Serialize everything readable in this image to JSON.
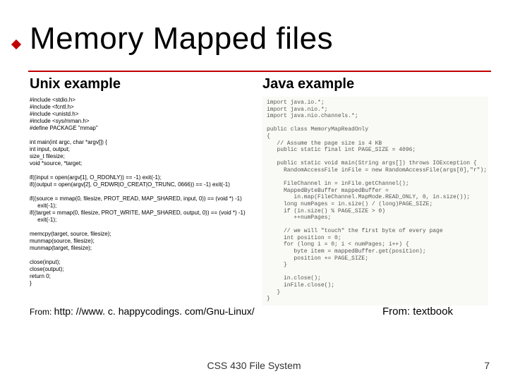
{
  "title": "Memory Mapped files",
  "left": {
    "heading": "Unix example",
    "code": "#include <stdio.h>\n#include <fcntl.h>\n#include <unistd.h>\n#include <sys/mman.h>\n#define PACKAGE \"mmap\"\n\nint main(int argc, char *argv[]) {\nint input, output;\nsize_t filesize;\nvoid *source, *target;\n\nif((input = open(argv[1], O_RDONLY)) == -1) exit(-1);\nif((output = open(argv[2], O_RDWR|O_CREAT|O_TRUNC, 0666)) == -1) exit(-1)\n\nif((source = mmap(0, filesize, PROT_READ, MAP_SHARED, input, 0)) == (void *) -1)\n     exit(-1);\nif((target = mmap(0, filesize, PROT_WRITE, MAP_SHARED, output, 0)) == (void *) -1)\n     exit(-1);\n\nmemcpy(target, source, filesize);\nmunmap(source, filesize);\nmunmap(target, filesize);\n\nclose(input);\nclose(output);\nreturn 0;\n}"
  },
  "right": {
    "heading": "Java example",
    "code": "import java.io.*;\nimport java.nio.*;\nimport java.nio.channels.*;\n\npublic class MemoryMapReadOnly\n{\n   // Assume the page size is 4 KB\n   public static final int PAGE_SIZE = 4096;\n\n   public static void main(String args[]) throws IOException {\n     RandomAccessFile inFile = new RandomAccessFile(args[0],\"r\");\n\n     FileChannel in = inFile.getChannel();\n     MappedByteBuffer mappedBuffer =\n        in.map(FileChannel.MapMode.READ_ONLY, 0, in.size());\n     long numPages = in.size() / (long)PAGE_SIZE;\n     if (in.size() % PAGE_SIZE > 0)\n        ++numPages;\n\n     // we will \"touch\" the first byte of every page\n     int position = 0;\n     for (long i = 0; i < numPages; i++) {\n        byte item = mappedBuffer.get(position);\n        position += PAGE_SIZE;\n     }\n\n     in.close();\n     inFile.close();\n   }\n}"
  },
  "source": {
    "leftPrefix": "From: ",
    "leftUrl": "http: //www. c. happycodings. com/Gnu-Linux/",
    "right": "From: textbook"
  },
  "footer": "CSS 430 File System",
  "page": "7"
}
